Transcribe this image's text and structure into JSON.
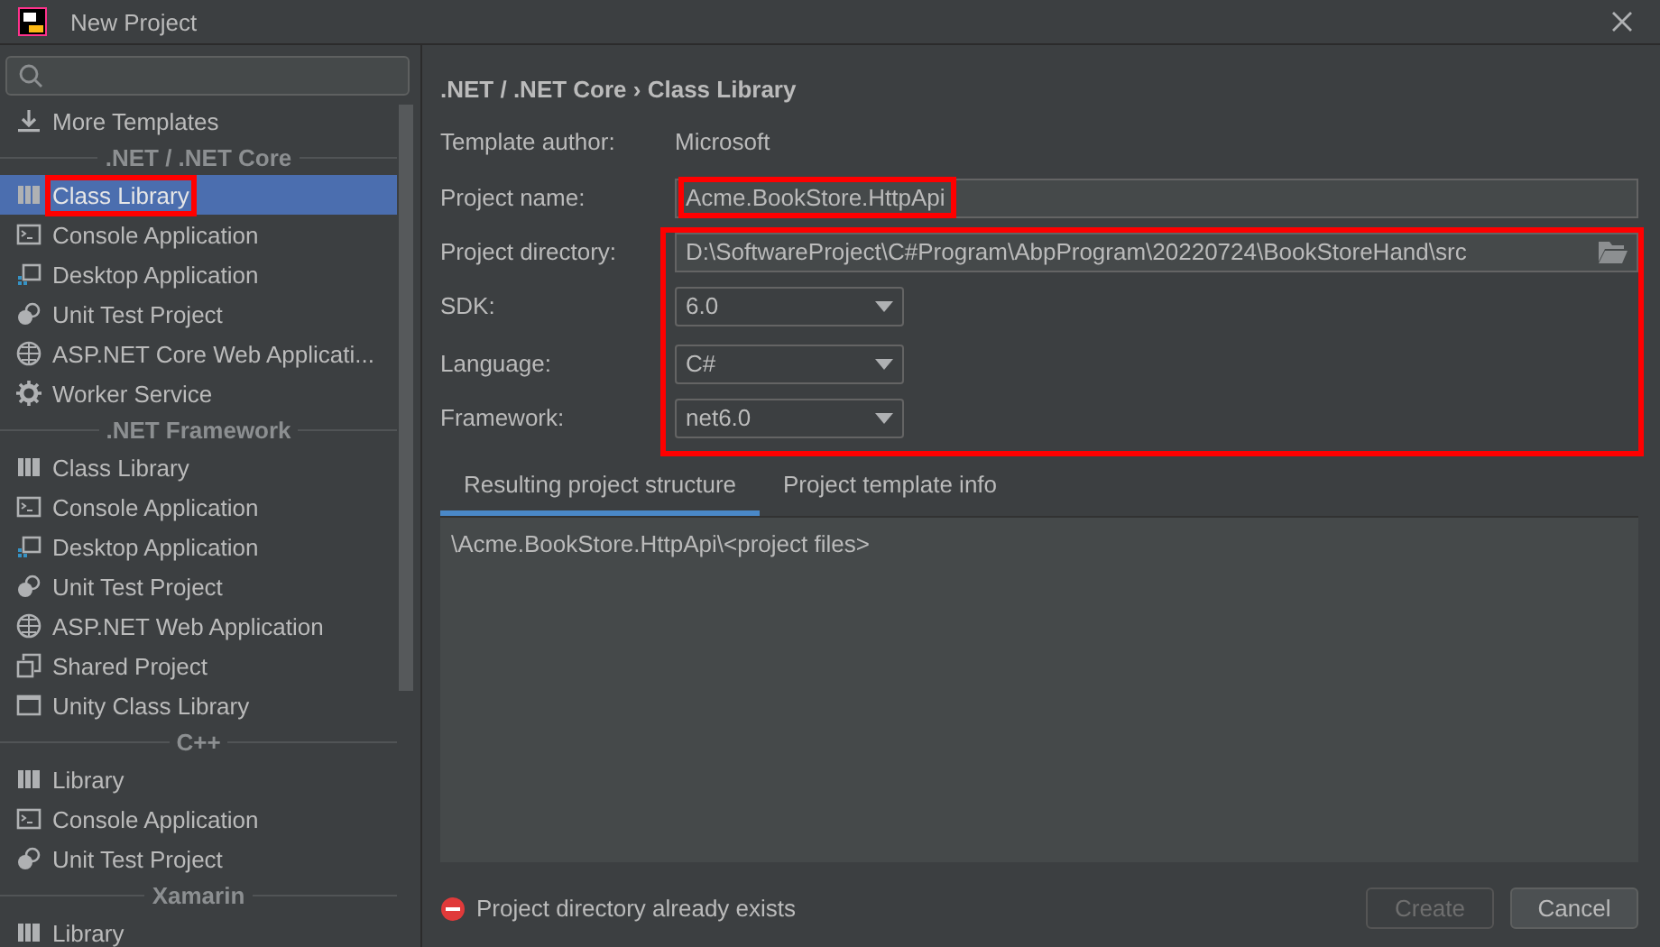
{
  "window": {
    "title": "New Project"
  },
  "sidebar": {
    "top_items": [
      {
        "label": "More Templates",
        "kind": "download",
        "selected": false,
        "highlighted": false
      }
    ],
    "sections": [
      {
        "title": ".NET / .NET Core",
        "items": [
          {
            "label": "Class Library",
            "kind": "library",
            "selected": true,
            "highlighted": true
          },
          {
            "label": "Console Application",
            "kind": "console",
            "selected": false,
            "highlighted": false
          },
          {
            "label": "Desktop Application",
            "kind": "desktop",
            "selected": false,
            "highlighted": false
          },
          {
            "label": "Unit Test Project",
            "kind": "test",
            "selected": false,
            "highlighted": false
          },
          {
            "label": "ASP.NET Core Web Applicati...",
            "kind": "globe",
            "selected": false,
            "highlighted": false
          },
          {
            "label": "Worker Service",
            "kind": "gear",
            "selected": false,
            "highlighted": false
          }
        ]
      },
      {
        "title": ".NET Framework",
        "items": [
          {
            "label": "Class Library",
            "kind": "library",
            "selected": false,
            "highlighted": false
          },
          {
            "label": "Console Application",
            "kind": "console",
            "selected": false,
            "highlighted": false
          },
          {
            "label": "Desktop Application",
            "kind": "desktop",
            "selected": false,
            "highlighted": false
          },
          {
            "label": "Unit Test Project",
            "kind": "test",
            "selected": false,
            "highlighted": false
          },
          {
            "label": "ASP.NET Web Application",
            "kind": "globe",
            "selected": false,
            "highlighted": false
          },
          {
            "label": "Shared Project",
            "kind": "shared",
            "selected": false,
            "highlighted": false
          },
          {
            "label": "Unity Class Library",
            "kind": "window",
            "selected": false,
            "highlighted": false
          }
        ]
      },
      {
        "title": "C++",
        "items": [
          {
            "label": "Library",
            "kind": "library",
            "selected": false,
            "highlighted": false
          },
          {
            "label": "Console Application",
            "kind": "console",
            "selected": false,
            "highlighted": false
          },
          {
            "label": "Unit Test Project",
            "kind": "test",
            "selected": false,
            "highlighted": false
          }
        ]
      },
      {
        "title": "Xamarin",
        "items": [
          {
            "label": "Library",
            "kind": "library",
            "selected": false,
            "highlighted": false
          }
        ]
      }
    ]
  },
  "main": {
    "breadcrumb": ".NET / .NET Core › Class Library",
    "template_author": {
      "label": "Template author:",
      "value": "Microsoft"
    },
    "project_name": {
      "label": "Project name:",
      "value": "Acme.BookStore.HttpApi",
      "highlighted": true
    },
    "settings_highlighted": true,
    "fields": [
      {
        "label": "Project directory:",
        "value": "D:\\SoftwareProject\\C#Program\\AbpProgram\\20220724\\BookStoreHand\\src",
        "kind": "path"
      },
      {
        "label": "SDK:",
        "value": "6.0",
        "kind": "dropdown"
      },
      {
        "label": "Language:",
        "value": "C#",
        "kind": "dropdown"
      },
      {
        "label": "Framework:",
        "value": "net6.0",
        "kind": "dropdown"
      }
    ],
    "tabs": [
      {
        "label": "Resulting project structure",
        "selected": true
      },
      {
        "label": "Project template info",
        "selected": false
      }
    ],
    "structure_text": "\\Acme.BookStore.HttpApi\\<project files>",
    "error": "Project directory already exists",
    "buttons": [
      {
        "label": "Create",
        "disabled": true
      },
      {
        "label": "Cancel",
        "disabled": false
      }
    ]
  }
}
